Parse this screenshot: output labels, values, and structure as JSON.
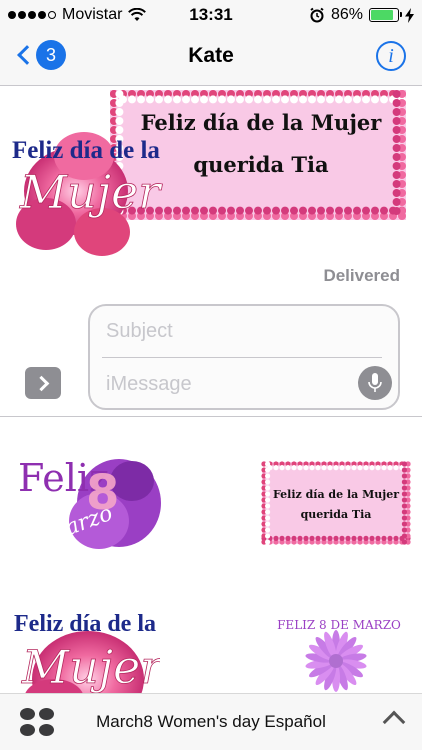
{
  "status_bar": {
    "carrier": "Movistar",
    "time": "13:31",
    "battery_percent": "86%",
    "battery_level": 0.86,
    "signal_bars": 4
  },
  "nav": {
    "back_badge": "3",
    "title": "Kate"
  },
  "conversation": {
    "sent_sticker": {
      "left_text_line1": "Feliz día de la",
      "left_text_line2": "Mujer",
      "card_line1": "Feliz día de la Mujer",
      "card_line2": "querida Tia"
    },
    "delivered_label": "Delivered"
  },
  "compose": {
    "subject_placeholder": "Subject",
    "message_placeholder": "iMessage"
  },
  "drawer": {
    "stickers": [
      {
        "line1": "Feliz",
        "line2": "8",
        "line3": "Marzo"
      },
      {
        "line1": "Feliz día de la Mujer",
        "line2": "querida Tia"
      },
      {
        "line1": "Feliz día de la",
        "line2": "Mujer"
      },
      {
        "line1": "FELIZ 8 DE MARZO"
      }
    ]
  },
  "bottom_bar": {
    "pack_title": "March8 Women's day Español"
  },
  "colors": {
    "accent": "#1a73e8",
    "card_pink": "#f9c9e6",
    "flower_pink": "#e0457b",
    "title_navy": "#1d2a8a",
    "purple": "#9a3fc4"
  }
}
